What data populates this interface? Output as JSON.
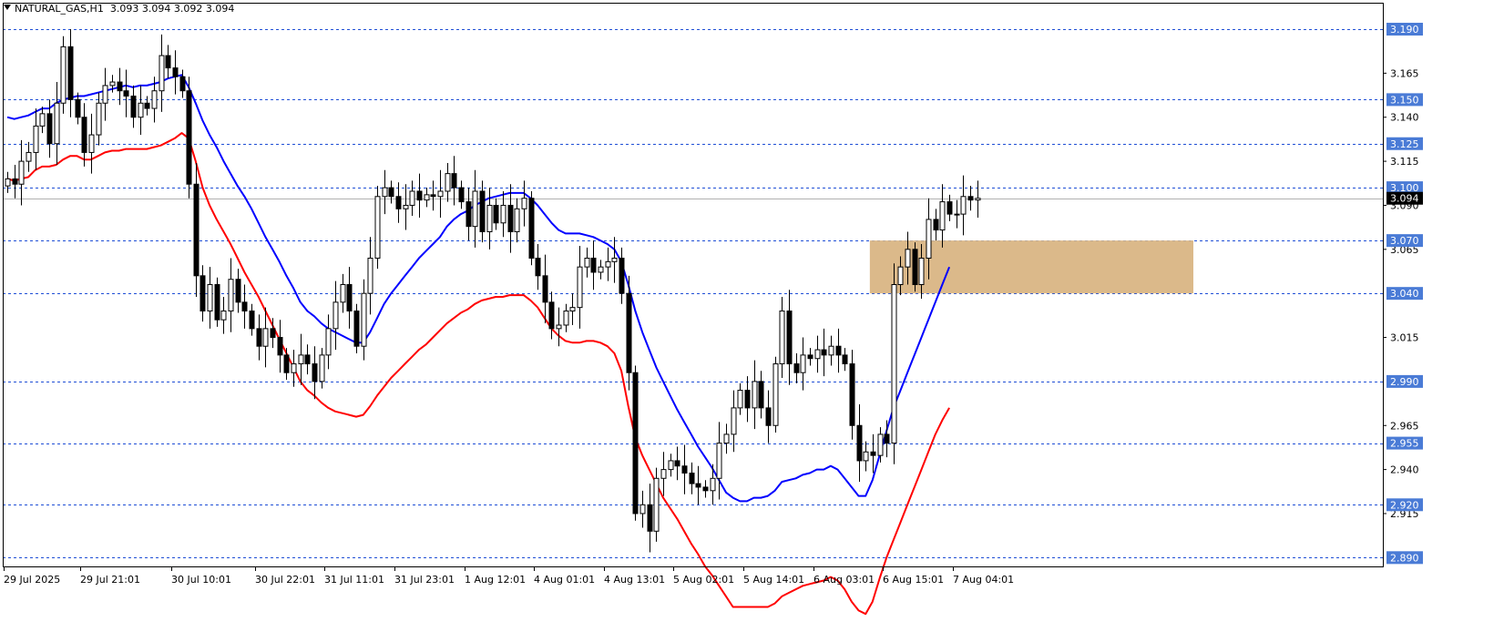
{
  "symbol": {
    "name": "NATURAL_GAS,H1",
    "open": "3.093",
    "high": "3.094",
    "low": "3.092",
    "close": "3.094"
  },
  "chart_data": {
    "type": "candlestick",
    "ylim": [
      2.885,
      3.205
    ],
    "price_ticks": [
      "3.165",
      "3.140",
      "3.115",
      "3.090",
      "3.065",
      "3.015",
      "2.965",
      "2.940",
      "2.915"
    ],
    "levels": [
      {
        "label": "3.190",
        "value": 3.19
      },
      {
        "label": "3.150",
        "value": 3.15
      },
      {
        "label": "3.125",
        "value": 3.125
      },
      {
        "label": "3.100",
        "value": 3.1
      },
      {
        "label": "3.070",
        "value": 3.07
      },
      {
        "label": "3.040",
        "value": 3.04
      },
      {
        "label": "2.990",
        "value": 2.99
      },
      {
        "label": "2.955",
        "value": 2.955
      },
      {
        "label": "2.920",
        "value": 2.92
      },
      {
        "label": "2.890",
        "value": 2.89
      }
    ],
    "current_price": {
      "label": "3.094",
      "value": 3.094
    },
    "zone": {
      "from_index": 124,
      "low": 3.04,
      "high": 3.07,
      "extends_to_right_edge": true
    },
    "time_labels": [
      {
        "label": "29 Jul 2025",
        "index": 0
      },
      {
        "label": "29 Jul 21:01",
        "index": 11
      },
      {
        "label": "30 Jul 10:01",
        "index": 24
      },
      {
        "label": "30 Jul 22:01",
        "index": 36
      },
      {
        "label": "31 Jul 11:01",
        "index": 46
      },
      {
        "label": "31 Jul 23:01",
        "index": 56
      },
      {
        "label": "1 Aug 12:01",
        "index": 66
      },
      {
        "label": "4 Aug 01:01",
        "index": 76
      },
      {
        "label": "4 Aug 13:01",
        "index": 86
      },
      {
        "label": "5 Aug 02:01",
        "index": 96
      },
      {
        "label": "5 Aug 14:01",
        "index": 106
      },
      {
        "label": "6 Aug 03:01",
        "index": 116
      },
      {
        "label": "6 Aug 15:01",
        "index": 126
      },
      {
        "label": "7 Aug 04:01",
        "index": 136
      }
    ],
    "close": [
      3.105,
      3.102,
      3.115,
      3.12,
      3.135,
      3.142,
      3.125,
      3.148,
      3.18,
      3.15,
      3.14,
      3.12,
      3.13,
      3.148,
      3.158,
      3.16,
      3.155,
      3.152,
      3.14,
      3.148,
      3.145,
      3.155,
      3.175,
      3.168,
      3.163,
      3.155,
      3.102,
      3.05,
      3.03,
      3.045,
      3.025,
      3.03,
      3.048,
      3.035,
      3.03,
      3.02,
      3.01,
      3.02,
      3.015,
      3.005,
      2.995,
      3.0,
      3.005,
      3.0,
      2.99,
      3.005,
      3.02,
      3.035,
      3.045,
      3.03,
      3.01,
      3.04,
      3.06,
      3.095,
      3.1,
      3.095,
      3.088,
      3.09,
      3.098,
      3.093,
      3.096,
      3.095,
      3.098,
      3.108,
      3.1,
      3.092,
      3.078,
      3.098,
      3.075,
      3.09,
      3.08,
      3.09,
      3.075,
      3.088,
      3.094,
      3.06,
      3.05,
      3.035,
      3.02,
      3.022,
      3.03,
      3.032,
      3.055,
      3.06,
      3.052,
      3.055,
      3.058,
      3.06,
      3.04,
      2.995,
      2.915,
      2.92,
      2.905,
      2.935,
      2.94,
      2.945,
      2.942,
      2.938,
      2.932,
      2.93,
      2.928,
      2.935,
      2.955,
      2.96,
      2.975,
      2.985,
      2.975,
      2.99,
      2.975,
      2.965,
      3.0,
      3.03,
      3.0,
      2.995,
      3.005,
      3.003,
      3.008,
      3.005,
      3.01,
      3.005,
      3.0,
      2.965,
      2.945,
      2.95,
      2.948,
      2.96,
      2.955,
      3.045,
      3.055,
      3.065,
      3.045,
      3.06,
      3.082,
      3.076,
      3.092,
      3.085,
      3.085,
      3.095,
      3.093,
      3.094
    ],
    "series": [
      {
        "name": "",
        "color": "#0000ff",
        "values": [
          3.14,
          3.139,
          3.14,
          3.141,
          3.143,
          3.145,
          3.145,
          3.148,
          3.15,
          3.151,
          3.152,
          3.152,
          3.153,
          3.154,
          3.155,
          3.156,
          3.157,
          3.158,
          3.157,
          3.158,
          3.158,
          3.159,
          3.16,
          3.162,
          3.163,
          3.164,
          3.157,
          3.148,
          3.138,
          3.13,
          3.123,
          3.115,
          3.108,
          3.101,
          3.095,
          3.088,
          3.08,
          3.072,
          3.065,
          3.058,
          3.05,
          3.043,
          3.035,
          3.03,
          3.027,
          3.023,
          3.02,
          3.018,
          3.016,
          3.014,
          3.012,
          3.012,
          3.018,
          3.026,
          3.034,
          3.04,
          3.045,
          3.05,
          3.055,
          3.06,
          3.064,
          3.068,
          3.072,
          3.078,
          3.082,
          3.085,
          3.087,
          3.09,
          3.092,
          3.094,
          3.095,
          3.096,
          3.097,
          3.097,
          3.097,
          3.094,
          3.09,
          3.085,
          3.08,
          3.076,
          3.074,
          3.074,
          3.074,
          3.073,
          3.072,
          3.07,
          3.068,
          3.065,
          3.058,
          3.045,
          3.03,
          3.018,
          3.008,
          2.998,
          2.99,
          2.982,
          2.974,
          2.967,
          2.96,
          2.953,
          2.947,
          2.941,
          2.934,
          2.927,
          2.924,
          2.922,
          2.922,
          2.924,
          2.924,
          2.925,
          2.928,
          2.933,
          2.934,
          2.935,
          2.937,
          2.938,
          2.94,
          2.94,
          2.942,
          2.94,
          2.935,
          2.93,
          2.925,
          2.925,
          2.934,
          2.948,
          2.962,
          2.975,
          2.985,
          2.995,
          3.005,
          3.015,
          3.025,
          3.035,
          3.045,
          3.055
        ]
      },
      {
        "name": "",
        "color": "#ff0000",
        "values": [
          3.105,
          3.104,
          3.105,
          3.106,
          3.11,
          3.112,
          3.112,
          3.113,
          3.116,
          3.118,
          3.118,
          3.116,
          3.116,
          3.118,
          3.12,
          3.121,
          3.121,
          3.122,
          3.122,
          3.122,
          3.122,
          3.123,
          3.124,
          3.126,
          3.128,
          3.131,
          3.128,
          3.115,
          3.1,
          3.09,
          3.082,
          3.075,
          3.068,
          3.06,
          3.052,
          3.045,
          3.038,
          3.03,
          3.022,
          3.014,
          3.006,
          2.998,
          2.99,
          2.985,
          2.982,
          2.978,
          2.975,
          2.973,
          2.972,
          2.971,
          2.97,
          2.971,
          2.976,
          2.982,
          2.987,
          2.992,
          2.996,
          3.0,
          3.004,
          3.008,
          3.011,
          3.015,
          3.019,
          3.023,
          3.026,
          3.029,
          3.031,
          3.034,
          3.036,
          3.037,
          3.038,
          3.038,
          3.039,
          3.039,
          3.039,
          3.036,
          3.032,
          3.026,
          3.02,
          3.016,
          3.013,
          3.012,
          3.012,
          3.013,
          3.013,
          3.012,
          3.01,
          3.006,
          2.996,
          2.976,
          2.958,
          2.948,
          2.94,
          2.932,
          2.924,
          2.918,
          2.912,
          2.905,
          2.898,
          2.892,
          2.885,
          2.88,
          2.874,
          2.868,
          2.862,
          2.862,
          2.862,
          2.862,
          2.862,
          2.862,
          2.864,
          2.868,
          2.87,
          2.872,
          2.874,
          2.875,
          2.876,
          2.877,
          2.879,
          2.877,
          2.872,
          2.865,
          2.86,
          2.858,
          2.865,
          2.878,
          2.89,
          2.9,
          2.91,
          2.92,
          2.93,
          2.94,
          2.95,
          2.96,
          2.968,
          2.975
        ]
      }
    ]
  }
}
